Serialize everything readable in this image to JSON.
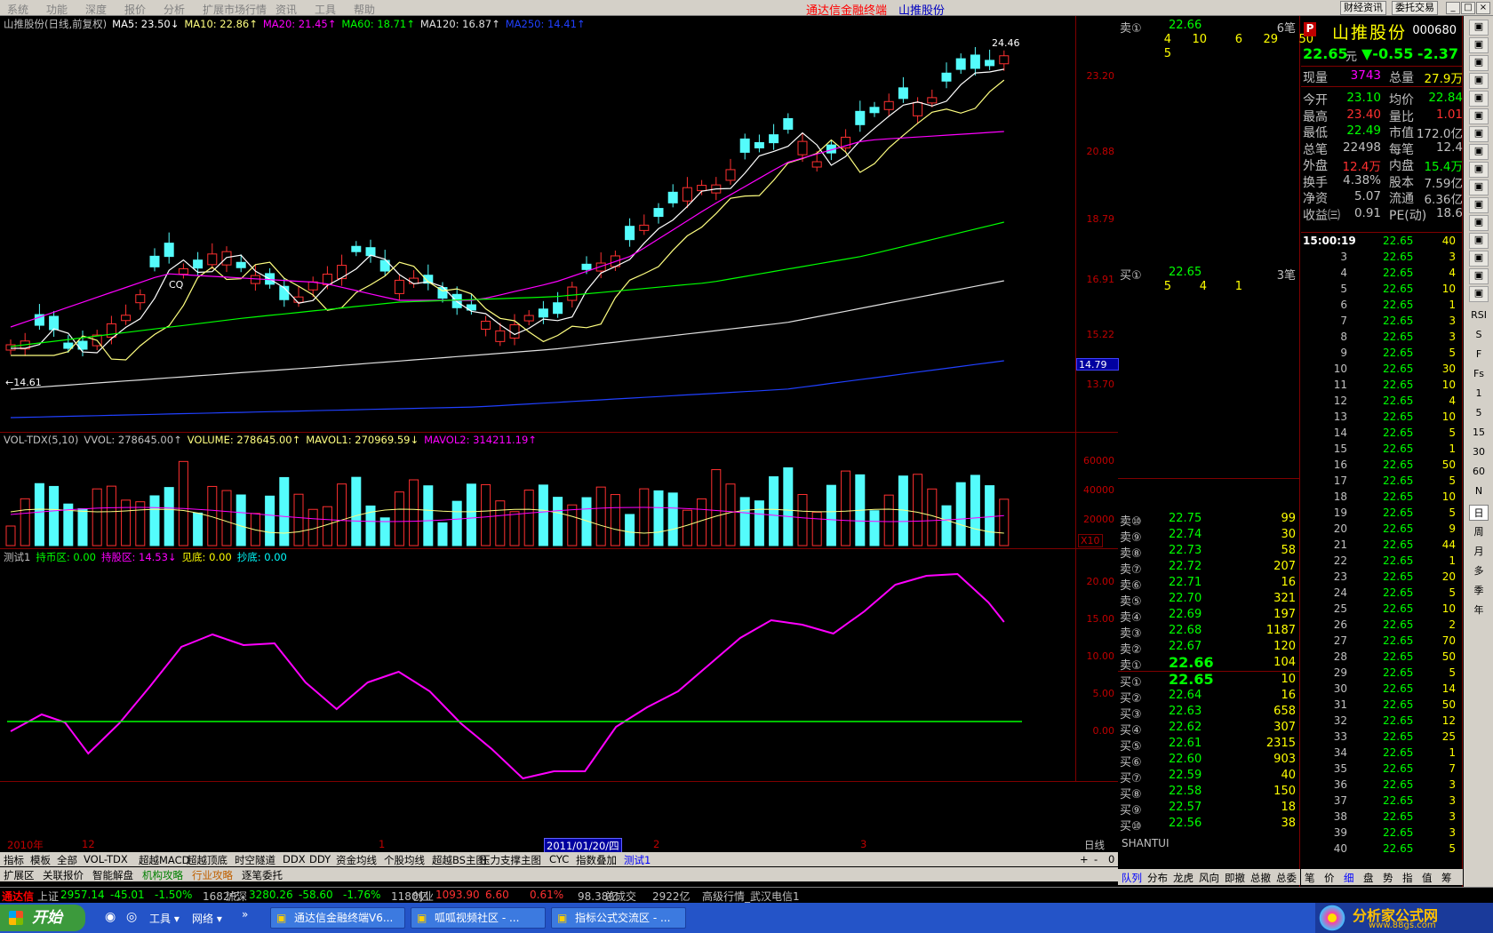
{
  "menu": [
    "系统",
    "功能",
    "深度",
    "报价",
    "分析",
    "扩展市场行情",
    "资讯",
    "工具",
    "帮助"
  ],
  "app_title": "通达信金融终端",
  "stock_title": "山推股份",
  "top_buttons": [
    "财经资讯",
    "委托交易"
  ],
  "main_header": {
    "name": "山推股份(日线,前复权)",
    "items": [
      {
        "text": "MA5: 23.50↓",
        "color": "#ffffff"
      },
      {
        "text": "MA10: 22.86↑",
        "color": "#ffff80"
      },
      {
        "text": "MA20: 21.45↑",
        "color": "#ff00ff"
      },
      {
        "text": "MA60: 18.71↑",
        "color": "#00ff00"
      },
      {
        "text": "MA120: 16.87↑",
        "color": "#e0e0e0"
      },
      {
        "text": "MA250: 14.41↑",
        "color": "#2040ff"
      }
    ]
  },
  "price_axis": [
    "23.20",
    "20.88",
    "18.79",
    "16.91",
    "15.22",
    "13.70"
  ],
  "current_marker": "14.79",
  "annotations": {
    "high": "24.46",
    "low": "←14.61",
    "cq": "CQ"
  },
  "vol_header": {
    "items": [
      {
        "text": "VOL-TDX(5,10)",
        "color": "#c0c0c0"
      },
      {
        "text": "VVOL: 278645.00↑",
        "color": "#c0c0c0"
      },
      {
        "text": "VOLUME: 278645.00↑",
        "color": "#ffff80"
      },
      {
        "text": "MAVOL1: 270969.59↓",
        "color": "#ffff80"
      },
      {
        "text": "MAVOL2: 314211.19↑",
        "color": "#ff00ff"
      }
    ]
  },
  "vol_axis": [
    "60000",
    "40000",
    "20000"
  ],
  "vol_unit": "X10",
  "ind_header": {
    "items": [
      {
        "text": "测试1",
        "color": "#c0c0c0"
      },
      {
        "text": "持币区: 0.00",
        "color": "#00ff00"
      },
      {
        "text": "持股区: 14.53↓",
        "color": "#ff00ff"
      },
      {
        "text": "见底: 0.00",
        "color": "#ffff00"
      },
      {
        "text": "抄底: 0.00",
        "color": "#00ffff"
      }
    ]
  },
  "ind_axis": [
    "20.00",
    "15.00",
    "10.00",
    "5.00",
    "0.00"
  ],
  "date_axis": {
    "year": "2010年",
    "m12": "12",
    "m1": "1",
    "cursor": "2011/01/20/四",
    "m2": "2",
    "m3": "3",
    "period": "日线"
  },
  "tabs1": [
    "指标",
    "模板",
    "全部",
    "VOL-TDX",
    "超越MACD",
    "超越顶底",
    "时空隧道",
    "DDX",
    "DDY",
    "资金均线",
    "个股均线",
    "超越BS主图",
    "压力支撑主图",
    "CYC",
    "指数叠加",
    "测试1"
  ],
  "tabs2": [
    "扩展区",
    "关联报价",
    "智能解盘",
    "机构攻略",
    "行业攻略",
    "逐笔委托"
  ],
  "tab_ctrl": [
    "+",
    "-",
    "0"
  ],
  "quote": {
    "sell1": {
      "label": "卖①",
      "price": "22.66",
      "count": "6笔",
      "orders": [
        "4",
        "10",
        "6",
        "29",
        "50",
        "5"
      ]
    },
    "buy1": {
      "label": "买①",
      "price": "22.65",
      "count": "3笔",
      "orders": [
        "5",
        "4",
        "1"
      ]
    },
    "footer": "SHANTUI",
    "ladder_sell": [
      {
        "l": "卖⑩",
        "p": "22.75",
        "v": "99"
      },
      {
        "l": "卖⑨",
        "p": "22.74",
        "v": "30"
      },
      {
        "l": "卖⑧",
        "p": "22.73",
        "v": "58"
      },
      {
        "l": "卖⑦",
        "p": "22.72",
        "v": "207"
      },
      {
        "l": "卖⑥",
        "p": "22.71",
        "v": "16"
      },
      {
        "l": "卖⑤",
        "p": "22.70",
        "v": "321"
      },
      {
        "l": "卖④",
        "p": "22.69",
        "v": "197"
      },
      {
        "l": "卖③",
        "p": "22.68",
        "v": "1187"
      },
      {
        "l": "卖②",
        "p": "22.67",
        "v": "120"
      },
      {
        "l": "卖①",
        "p": "22.66",
        "v": "104"
      }
    ],
    "ladder_buy": [
      {
        "l": "买①",
        "p": "22.65",
        "v": "10"
      },
      {
        "l": "买②",
        "p": "22.64",
        "v": "16"
      },
      {
        "l": "买③",
        "p": "22.63",
        "v": "658"
      },
      {
        "l": "买④",
        "p": "22.62",
        "v": "307"
      },
      {
        "l": "买⑤",
        "p": "22.61",
        "v": "2315"
      },
      {
        "l": "买⑥",
        "p": "22.60",
        "v": "903"
      },
      {
        "l": "买⑦",
        "p": "22.59",
        "v": "40"
      },
      {
        "l": "买⑧",
        "p": "22.58",
        "v": "150"
      },
      {
        "l": "买⑨",
        "p": "22.57",
        "v": "18"
      },
      {
        "l": "买⑩",
        "p": "22.56",
        "v": "38"
      }
    ],
    "bottom_tabs": [
      "队列",
      "分布",
      "龙虎",
      "风向",
      "即撤",
      "总撤",
      "总委"
    ]
  },
  "info": {
    "badge": "P",
    "name": "山推股份",
    "code": "000680",
    "price": "22.65",
    "unit": "元",
    "change": "▼-0.55",
    "pct": "-2.37",
    "rows": [
      [
        {
          "k": "现量",
          "v": "3743",
          "c": "#ff00ff"
        },
        {
          "k": "总量",
          "v": "27.9万",
          "c": "#ffff00"
        }
      ],
      [
        {
          "k": "今开",
          "v": "23.10",
          "c": "#00ff00"
        },
        {
          "k": "均价",
          "v": "22.84",
          "c": "#00ff00"
        }
      ],
      [
        {
          "k": "最高",
          "v": "23.40",
          "c": "#ff3030"
        },
        {
          "k": "量比",
          "v": "1.01",
          "c": "#ff3030"
        }
      ],
      [
        {
          "k": "最低",
          "v": "22.49",
          "c": "#00ff00"
        },
        {
          "k": "市值",
          "v": "172.0亿",
          "c": "#c0c0c0"
        }
      ],
      [
        {
          "k": "总笔",
          "v": "22498",
          "c": "#c0c0c0"
        },
        {
          "k": "每笔",
          "v": "12.4",
          "c": "#c0c0c0"
        }
      ],
      [
        {
          "k": "外盘",
          "v": "12.4万",
          "c": "#ff3030"
        },
        {
          "k": "内盘",
          "v": "15.4万",
          "c": "#00ff00"
        }
      ],
      [
        {
          "k": "换手",
          "v": "4.38%",
          "c": "#c0c0c0"
        },
        {
          "k": "股本",
          "v": "7.59亿",
          "c": "#c0c0c0"
        }
      ],
      [
        {
          "k": "净资",
          "v": "5.07",
          "c": "#c0c0c0"
        },
        {
          "k": "流通",
          "v": "6.36亿",
          "c": "#c0c0c0"
        }
      ],
      [
        {
          "k": "收益㈢",
          "v": "0.91",
          "c": "#c0c0c0"
        },
        {
          "k": "PE(动)",
          "v": "18.6",
          "c": "#c0c0c0"
        }
      ]
    ],
    "ticks_first_time": "15:00:19",
    "ticks": [
      [
        "15:00:19",
        "22.65",
        "40"
      ],
      [
        "3",
        "22.65",
        "3"
      ],
      [
        "4",
        "22.65",
        "4"
      ],
      [
        "5",
        "22.65",
        "10"
      ],
      [
        "6",
        "22.65",
        "1"
      ],
      [
        "7",
        "22.65",
        "3"
      ],
      [
        "8",
        "22.65",
        "3"
      ],
      [
        "9",
        "22.65",
        "5"
      ],
      [
        "10",
        "22.65",
        "30"
      ],
      [
        "11",
        "22.65",
        "10"
      ],
      [
        "12",
        "22.65",
        "4"
      ],
      [
        "13",
        "22.65",
        "10"
      ],
      [
        "14",
        "22.65",
        "5"
      ],
      [
        "15",
        "22.65",
        "1"
      ],
      [
        "16",
        "22.65",
        "50"
      ],
      [
        "17",
        "22.65",
        "5"
      ],
      [
        "18",
        "22.65",
        "10"
      ],
      [
        "19",
        "22.65",
        "5"
      ],
      [
        "20",
        "22.65",
        "9"
      ],
      [
        "21",
        "22.65",
        "44"
      ],
      [
        "22",
        "22.65",
        "1"
      ],
      [
        "23",
        "22.65",
        "20"
      ],
      [
        "24",
        "22.65",
        "5"
      ],
      [
        "25",
        "22.65",
        "10"
      ],
      [
        "26",
        "22.65",
        "2"
      ],
      [
        "27",
        "22.65",
        "70"
      ],
      [
        "28",
        "22.65",
        "50"
      ],
      [
        "29",
        "22.65",
        "5"
      ],
      [
        "30",
        "22.65",
        "14"
      ],
      [
        "31",
        "22.65",
        "50"
      ],
      [
        "32",
        "22.65",
        "12"
      ],
      [
        "33",
        "22.65",
        "25"
      ],
      [
        "34",
        "22.65",
        "1"
      ],
      [
        "35",
        "22.65",
        "7"
      ],
      [
        "36",
        "22.65",
        "3"
      ],
      [
        "37",
        "22.65",
        "3"
      ],
      [
        "38",
        "22.65",
        "3"
      ],
      [
        "39",
        "22.65",
        "3"
      ],
      [
        "40",
        "22.65",
        "5"
      ]
    ],
    "bottom_tabs": [
      "笔",
      "价",
      "细",
      "盘",
      "势",
      "指",
      "值",
      "筹"
    ]
  },
  "side_tools": [
    "RSI",
    "S",
    "F",
    "Fs",
    "1",
    "5",
    "15",
    "30",
    "60",
    "N",
    "日",
    "周",
    "月",
    "多",
    "季",
    "年"
  ],
  "status": {
    "brand": "通达信",
    "sh": {
      "name": "上证",
      "v": "2957.14",
      "d": "-45.01",
      "p": "-1.50%",
      "a": "1682亿"
    },
    "sz": {
      "name": "沪深",
      "v": "3280.26",
      "d": "-58.60",
      "p": "-1.76%",
      "a": "1180亿"
    },
    "cy": {
      "name": "创业",
      "v": "1093.90",
      "d": "6.60",
      "p": "0.61%",
      "a": "98.38亿"
    },
    "total": "总成交",
    "total_v": "2922亿",
    "server": "高级行情_武汉电信1"
  },
  "taskbar": {
    "start": "开始",
    "tools": [
      "工具 ▾",
      "网络 ▾"
    ],
    "windows": [
      "通达信金融终端V6...",
      "呱呱视频社区  - ...",
      "指标公式交流区 - ..."
    ],
    "logo": "分析家公式网",
    "logo_url": "www.88gs.com"
  },
  "colors": {
    "up": "#ff3030",
    "down": "#54fcfc",
    "frame": "#800000",
    "ma5": "#ffffff",
    "ma10": "#ffff80",
    "ma20": "#ff00ff",
    "ma60": "#00ff00",
    "ma120": "#e0e0e0",
    "ma250": "#2040ff"
  }
}
